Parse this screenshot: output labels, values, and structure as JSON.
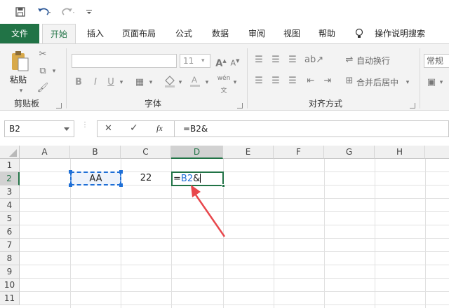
{
  "qat": {
    "save_icon": "save-icon",
    "undo_icon": "undo-icon",
    "redo_icon": "redo-icon",
    "customize_icon": "customize-icon"
  },
  "tabs": {
    "file": "文件",
    "home": "开始",
    "insert": "插入",
    "page_layout": "页面布局",
    "formulas": "公式",
    "data": "数据",
    "review": "审阅",
    "view": "视图",
    "help": "帮助",
    "tell_me": "操作说明搜索"
  },
  "ribbon": {
    "clipboard": {
      "paste": "粘贴",
      "label": "剪贴板"
    },
    "font": {
      "size": "11",
      "bold": "B",
      "italic": "I",
      "underline": "U",
      "label": "字体",
      "phonetic": "wén"
    },
    "alignment": {
      "wrap": "自动换行",
      "merge": "合并后居中",
      "label": "对齐方式"
    },
    "number": {
      "format": "常规"
    }
  },
  "formula_bar": {
    "name_box": "B2",
    "cancel": "✕",
    "enter": "✓",
    "fx": "fx",
    "formula": "=B2&"
  },
  "grid": {
    "columns": [
      "A",
      "B",
      "C",
      "D",
      "E",
      "F",
      "G",
      "H"
    ],
    "rows": [
      "1",
      "2",
      "3",
      "4",
      "5",
      "6",
      "7",
      "8",
      "9",
      "10",
      "11"
    ],
    "cells": {
      "B2": "AA",
      "C2": "22",
      "D2_ref": "B2",
      "D2_prefix": "=",
      "D2_suffix": "&"
    }
  },
  "colors": {
    "accent": "#217346",
    "ref_blue": "#1e6fd6",
    "arrow": "#e8474c"
  }
}
